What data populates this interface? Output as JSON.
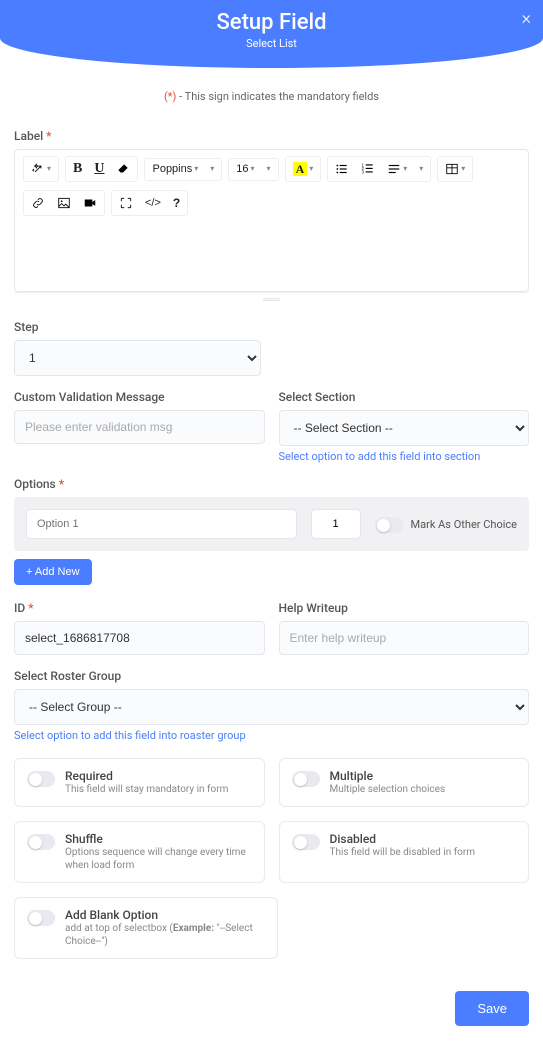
{
  "header": {
    "title": "Setup Field",
    "subtitle": "Select List",
    "close": "×"
  },
  "hint": {
    "mark": "(*)",
    "text": " - This sign indicates the mandatory fields"
  },
  "labels": {
    "label": "Label",
    "step": "Step",
    "custom_validation": "Custom Validation Message",
    "select_section": "Select Section",
    "options": "Options",
    "id": "ID",
    "help_writeup": "Help Writeup",
    "roster": "Select Roster Group"
  },
  "toolbar": {
    "font": "Poppins",
    "size": "16"
  },
  "step": {
    "value": "1"
  },
  "validation": {
    "placeholder": "Please enter validation msg"
  },
  "section": {
    "placeholder": "-- Select Section --",
    "help": "Select option to add this field into section"
  },
  "option_row": {
    "name_placeholder": "Option 1",
    "order": "1",
    "mark_other": "Mark As Other Choice"
  },
  "add_new": "+ Add New",
  "id_field": {
    "value": "select_1686817708"
  },
  "help_field": {
    "placeholder": "Enter help writeup"
  },
  "roster": {
    "placeholder": "-- Select Group --",
    "help": "Select option to add this field into roaster group"
  },
  "toggles": {
    "required": {
      "title": "Required",
      "desc": "This field will stay mandatory in form"
    },
    "multiple": {
      "title": "Multiple",
      "desc": "Multiple selection choices"
    },
    "shuffle": {
      "title": "Shuffle",
      "desc": "Options sequence will change every time when load form"
    },
    "disabled": {
      "title": "Disabled",
      "desc": "This field will be disabled in form"
    },
    "blank": {
      "title": "Add Blank Option",
      "desc_pre": "add at top of selectbox\n(",
      "desc_bold": "Example:",
      "desc_post": " \"--Select Choice--\")"
    }
  },
  "save": "Save"
}
